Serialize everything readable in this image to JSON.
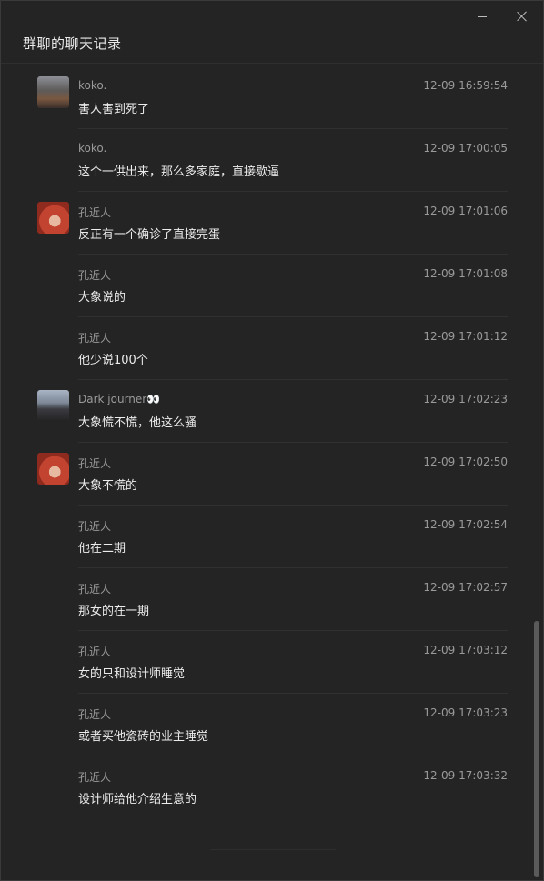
{
  "window": {
    "title": "群聊的聊天记录",
    "minimize_icon": "minimize-icon",
    "close_icon": "close-icon"
  },
  "messages": [
    {
      "name": "koko.",
      "time": "12-09 16:59:54",
      "text": "害人害到死了",
      "avatar": "avatar-koko"
    },
    {
      "name": "koko.",
      "time": "12-09 17:00:05",
      "text": "这个一供出来，那么多家庭，直接歇逼",
      "avatar": null
    },
    {
      "name": "孔近人",
      "time": "12-09 17:01:06",
      "text": "反正有一个确诊了直接完蛋",
      "avatar": "avatar-kong"
    },
    {
      "name": "孔近人",
      "time": "12-09 17:01:08",
      "text": "大象说的",
      "avatar": null
    },
    {
      "name": "孔近人",
      "time": "12-09 17:01:12",
      "text": "他少说100个",
      "avatar": null
    },
    {
      "name": "Dark journer👀",
      "time": "12-09 17:02:23",
      "text": "大象慌不慌，他这么骚",
      "avatar": "avatar-dark"
    },
    {
      "name": "孔近人",
      "time": "12-09 17:02:50",
      "text": "大象不慌的",
      "avatar": "avatar-kong"
    },
    {
      "name": "孔近人",
      "time": "12-09 17:02:54",
      "text": "他在二期",
      "avatar": null
    },
    {
      "name": "孔近人",
      "time": "12-09 17:02:57",
      "text": "那女的在一期",
      "avatar": null
    },
    {
      "name": "孔近人",
      "time": "12-09 17:03:12",
      "text": "女的只和设计师睡觉",
      "avatar": null
    },
    {
      "name": "孔近人",
      "time": "12-09 17:03:23",
      "text": "或者买他瓷砖的业主睡觉",
      "avatar": null
    },
    {
      "name": "孔近人",
      "time": "12-09 17:03:32",
      "text": "设计师给他介绍生意的",
      "avatar": null
    }
  ]
}
